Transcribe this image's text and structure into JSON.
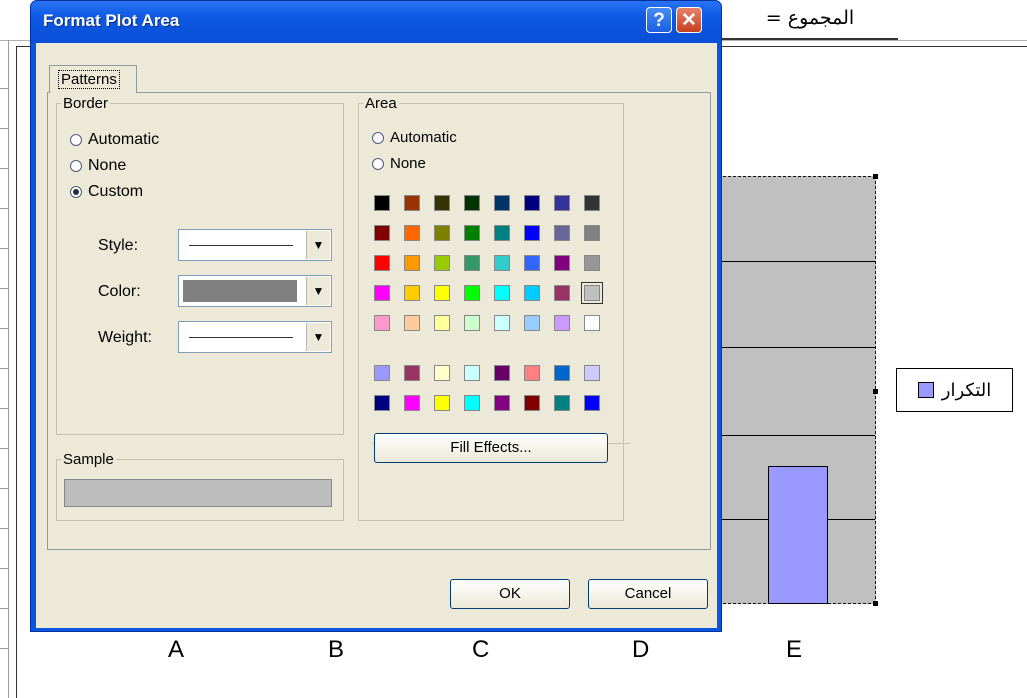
{
  "sheet": {
    "formula_text": "المجموع =",
    "legend_label": "التكرار",
    "axis_labels": [
      "A",
      "B",
      "C",
      "D",
      "E"
    ],
    "series_color": "#9999ff",
    "plot_bg_color": "#c0c0c0"
  },
  "dialog": {
    "title": "Format Plot Area",
    "help_label": "?",
    "close_label": "✕",
    "tab_label": "Patterns",
    "border": {
      "legend": "Border",
      "options": [
        "Automatic",
        "None",
        "Custom"
      ],
      "selected": "Custom",
      "style_label": "Style:",
      "color_label": "Color:",
      "weight_label": "Weight:",
      "color_value": "#808080"
    },
    "sample": {
      "legend": "Sample",
      "color": "#bdbdbd"
    },
    "area": {
      "legend": "Area",
      "options": [
        "Automatic",
        "None"
      ],
      "selected_color": "#c0c0c0",
      "fill_effects_label": "Fill Effects...",
      "palette": [
        [
          "#000000",
          "#993300",
          "#333300",
          "#003300",
          "#003366",
          "#000080",
          "#333399",
          "#333333"
        ],
        [
          "#800000",
          "#ff6600",
          "#808000",
          "#008000",
          "#008080",
          "#0000ff",
          "#666699",
          "#808080"
        ],
        [
          "#ff0000",
          "#ff9900",
          "#99cc00",
          "#339966",
          "#33cccc",
          "#3366ff",
          "#800080",
          "#969696"
        ],
        [
          "#ff00ff",
          "#ffcc00",
          "#ffff00",
          "#00ff00",
          "#00ffff",
          "#00ccff",
          "#993366",
          "#c0c0c0"
        ],
        [
          "#ff99cc",
          "#ffcc99",
          "#ffff99",
          "#ccffcc",
          "#ccffff",
          "#99ccff",
          "#cc99ff",
          "#ffffff"
        ]
      ],
      "chart_palette": [
        [
          "#9999ff",
          "#993366",
          "#ffffcc",
          "#ccffff",
          "#660066",
          "#ff8080",
          "#0066cc",
          "#ccccff"
        ],
        [
          "#000080",
          "#ff00ff",
          "#ffff00",
          "#00ffff",
          "#800080",
          "#800000",
          "#008080",
          "#0000ff"
        ]
      ]
    },
    "ok_label": "OK",
    "cancel_label": "Cancel"
  }
}
